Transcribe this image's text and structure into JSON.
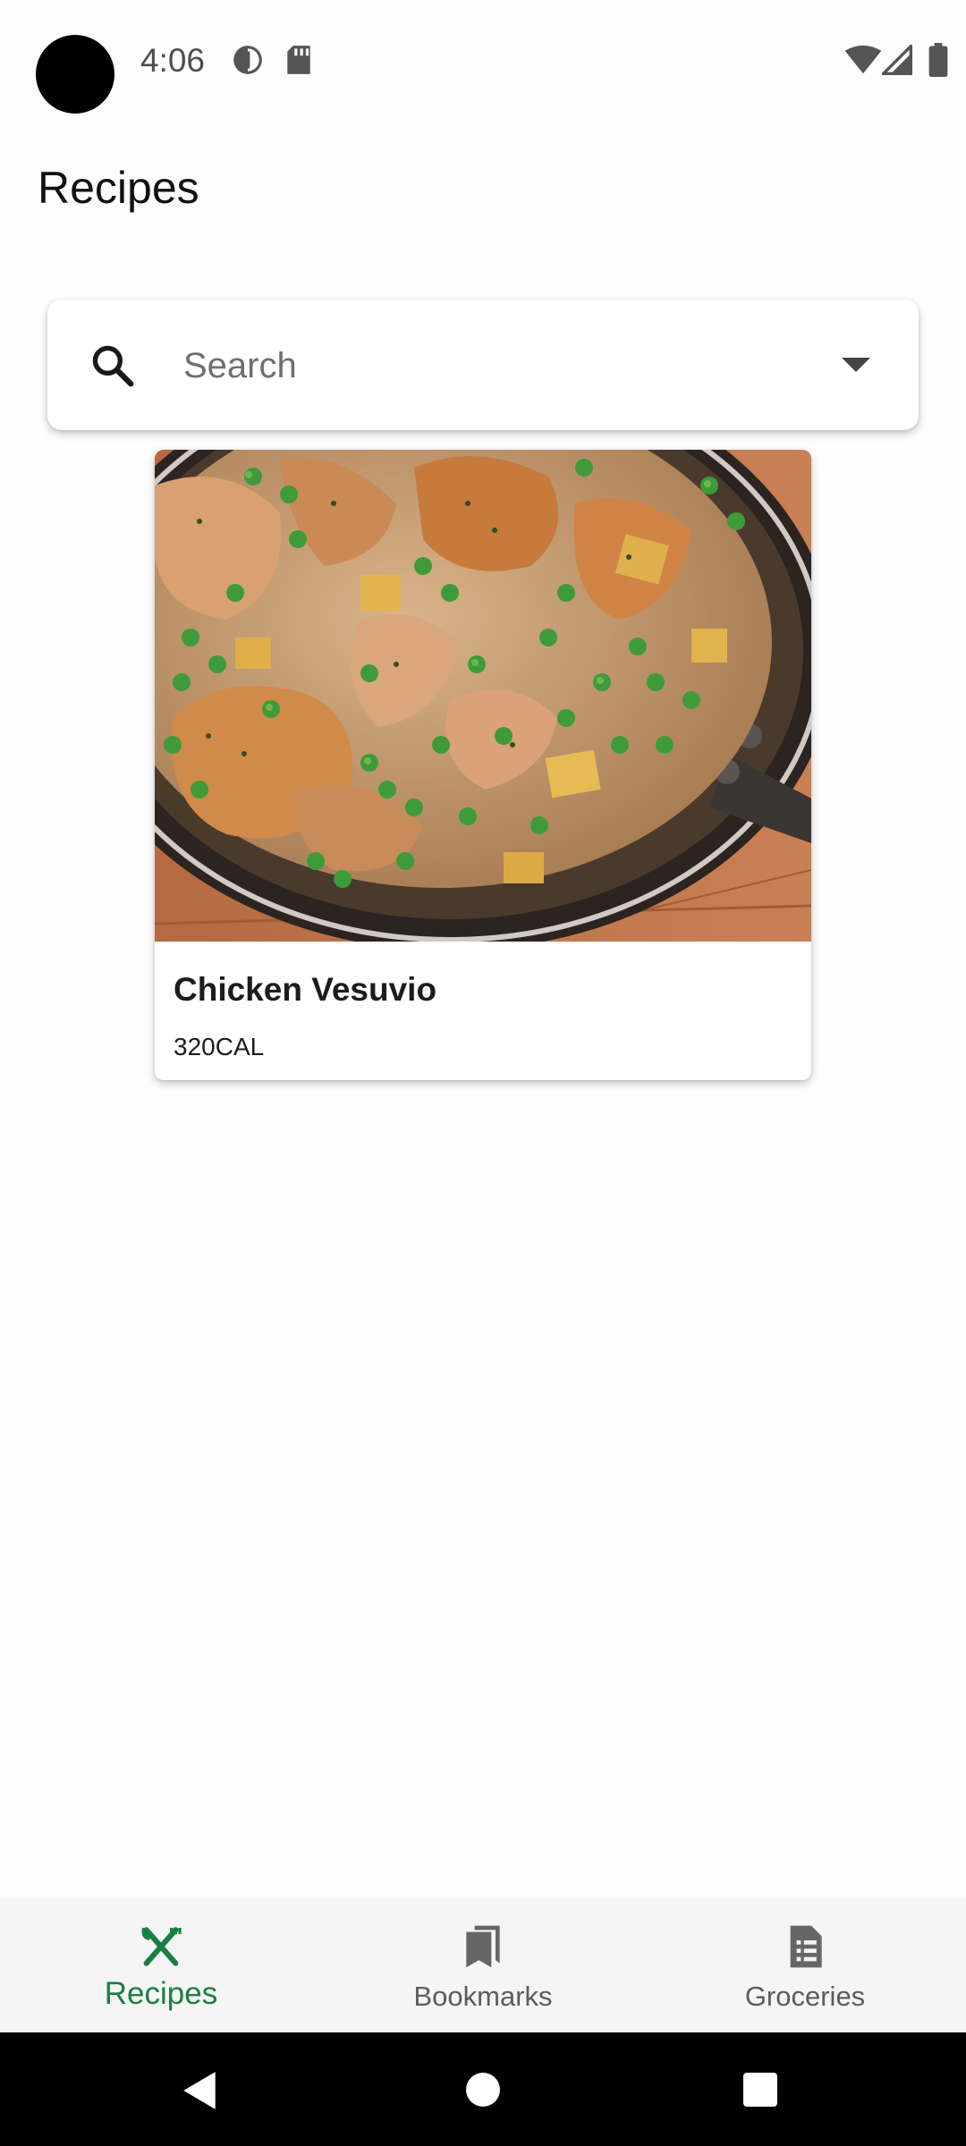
{
  "status_bar": {
    "time": "4:06",
    "icons": [
      "camera-cutout",
      "data-saver-icon",
      "sd-card-icon",
      "wifi-icon",
      "signal-icon",
      "battery-icon"
    ]
  },
  "header": {
    "title": "Recipes"
  },
  "search": {
    "placeholder": "Search",
    "value": ""
  },
  "recipes": [
    {
      "name": "Chicken Vesuvio",
      "calories": "320CAL"
    }
  ],
  "bottom_nav": {
    "items": [
      {
        "label": "Recipes",
        "icon": "fork-knife-icon",
        "active": true
      },
      {
        "label": "Bookmarks",
        "icon": "bookmarks-icon",
        "active": false
      },
      {
        "label": "Groceries",
        "icon": "grocery-list-icon",
        "active": false
      }
    ]
  },
  "colors": {
    "accent": "#1a7f44",
    "inactive": "#5c5c5c",
    "background": "#fefdfd",
    "nav_background": "#f5f5f5"
  }
}
